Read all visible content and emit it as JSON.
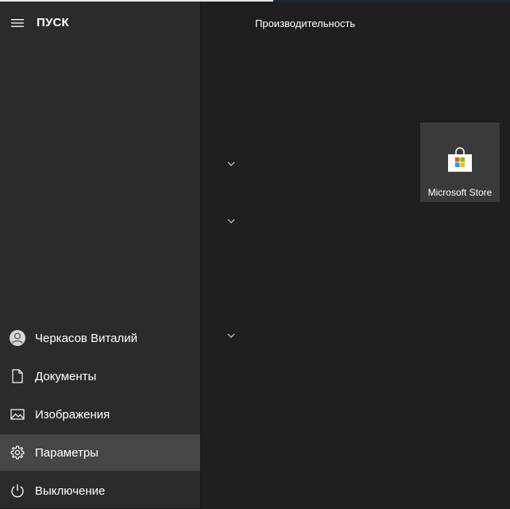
{
  "start_menu": {
    "title": "ПУСК",
    "icons": {
      "menu": "hamburger-icon"
    }
  },
  "left_menu": {
    "items": [
      {
        "label": "Черкасов Виталий",
        "icon": "user-avatar-icon"
      },
      {
        "label": "Документы",
        "icon": "document-icon"
      },
      {
        "label": "Изображения",
        "icon": "image-icon"
      },
      {
        "label": "Параметры",
        "icon": "gear-icon",
        "active": true
      },
      {
        "label": "Выключение",
        "icon": "power-icon"
      }
    ]
  },
  "tiles_area": {
    "group_title": "Производительность",
    "tiles": [
      {
        "label": "Microsoft Store",
        "icon": "microsoft-store-icon"
      }
    ]
  },
  "colors": {
    "left_pane": "#2b2b2b",
    "tiles_bg": "#1f1f1f",
    "active_item": "#464646",
    "tile_bg": "#3a3a3a"
  }
}
